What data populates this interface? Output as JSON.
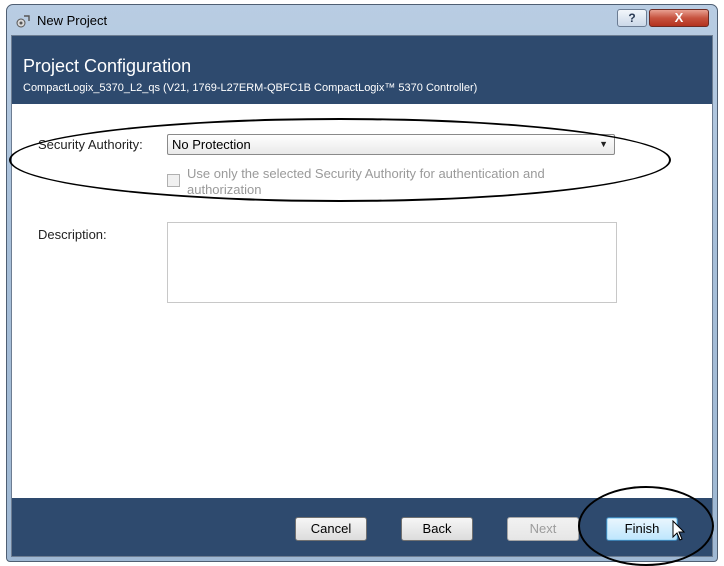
{
  "window": {
    "title": "New Project",
    "help_label": "?",
    "close_label": "X"
  },
  "header": {
    "title": "Project Configuration",
    "subtitle": "CompactLogix_5370_L2_qs (V21, 1769-L27ERM-QBFC1B CompactLogix™ 5370 Controller)"
  },
  "form": {
    "security_authority_label": "Security Authority:",
    "security_authority_value": "No Protection",
    "use_only_checkbox_label": "Use only the selected Security Authority for authentication and authorization",
    "use_only_checked": false,
    "description_label": "Description:",
    "description_value": ""
  },
  "buttons": {
    "cancel": "Cancel",
    "back": "Back",
    "next": "Next",
    "finish": "Finish"
  },
  "colors": {
    "header_band": "#2e4a6e",
    "footer_band": "#2e4a6e"
  },
  "icons": {
    "app": "new-project-icon",
    "dropdown": "chevron-down-icon",
    "cursor": "mouse-pointer-icon"
  }
}
